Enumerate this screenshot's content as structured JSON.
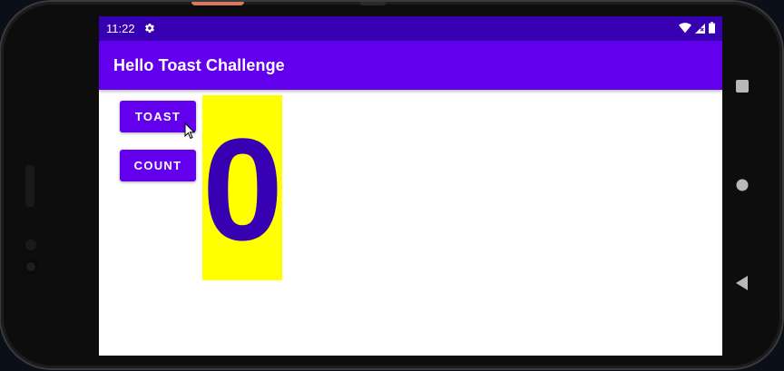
{
  "status_bar": {
    "time": "11:22",
    "settings_icon": "gear-icon",
    "wifi_icon": "wifi-icon",
    "signal_icon": "cell-signal-icon",
    "battery_icon": "battery-icon",
    "color": "#3700b3"
  },
  "app_bar": {
    "title": "Hello Toast Challenge",
    "color": "#6200ee"
  },
  "buttons": {
    "toast_label": "TOAST",
    "count_label": "COUNT",
    "color": "#6200ee"
  },
  "counter": {
    "value": "0",
    "text_color": "#3700b3",
    "background": "#ffff00"
  },
  "nav_bar": {
    "recents_icon": "recents-square-icon",
    "home_icon": "home-circle-icon",
    "back_icon": "back-triangle-icon"
  }
}
